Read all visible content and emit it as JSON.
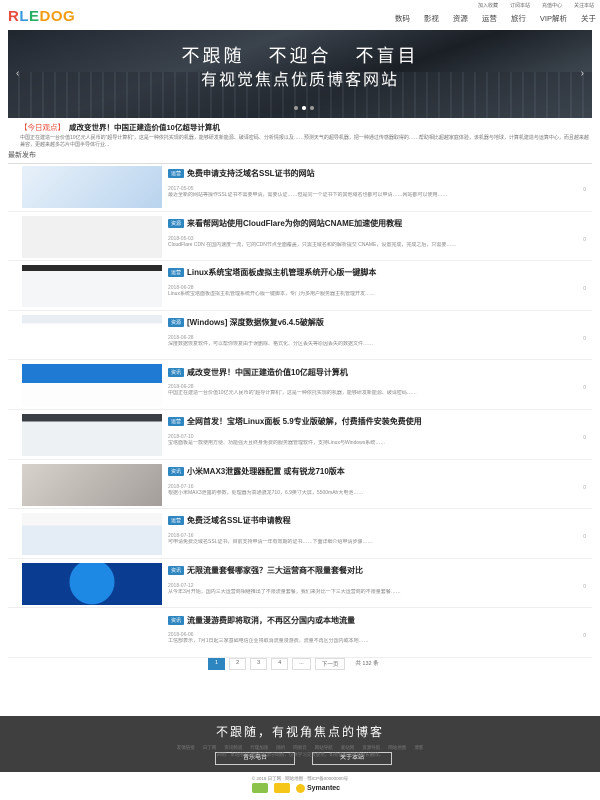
{
  "header": {
    "logo": [
      "R",
      "L",
      "E",
      "DOG"
    ],
    "top_links": [
      "加入收藏",
      "订阅本站",
      "充值中心",
      "关注本站"
    ],
    "nav": [
      "数码",
      "影视",
      "资源",
      "运营",
      "旅行",
      "VIP解析",
      "关于"
    ]
  },
  "banner": {
    "line1": "不跟随  不迎合  不盲目",
    "line2": "有视觉焦点优质博客网站",
    "prev": "‹",
    "next": "›"
  },
  "today": {
    "tag": "【今日观点】",
    "title": "咸改变世界！中国正建造价值10亿超导计算机",
    "excerpt": "中国正在建造一台价值10亿元人民币的“超导计算机”，这是一种依托实现的机器，能够研发新能源、破译密码、分析情报以及……预测天气的超导机器，把一种通过传感器取得的……帮助相比超越家庭体验，该机器与地球，计算机建造与运算中心，而且越来越兼容，更越来越多芯片中国半导体行业..."
  },
  "section_title": "最新发布",
  "posts": [
    {
      "cat": "运营",
      "title": "免费申请支持泛域名SSL证书的网站",
      "date": "2017-05-05",
      "excerpt": "最近全新的网站等操作SSL证书不需要申请，需要认证……但是同一个证书下的其他域名也都可以申请……网站都可以使用……",
      "views": "0"
    },
    {
      "cat": "资源",
      "title": "来看帮网站使用CloudFlare为你的网站CNAME加速使用教程",
      "date": "2018-05-03",
      "excerpt": "CloudFlare CDN 在国内速度一流，它的CDN节点全面覆盖，只需主域名和的解析提交 CNAME，设置完成，完成之后，只需要……",
      "views": "0"
    },
    {
      "cat": "运营",
      "title": "Linux系统宝塔面板虚拟主机管理系统开心版一键脚本",
      "date": "2018-06-28",
      "excerpt": "Linux系统宝塔面板虚拟主机管理系统开心版一键脚本，专门为多用户服务器主机管理开发……",
      "views": "0"
    },
    {
      "cat": "资源",
      "title": "[Windows] 深度数据恢复v6.4.5破解版",
      "date": "2018-06-28",
      "excerpt": "深度数据恢复软件，可以帮你恢复由于误删除、格式化、分区丢失等原因丢失的数据文件……",
      "views": "0"
    },
    {
      "cat": "资讯",
      "title": "咸改变世界！中国正建造价值10亿超导计算机",
      "date": "2018-06-28",
      "excerpt": "中国正在建造一台价值10亿元人民币的“超导计算机”，这是一种依托实现的机器，能够研发新能源、破译密码……",
      "views": "0"
    },
    {
      "cat": "运营",
      "title": "全网首发！宝塔Linux面板 5.9专业版破解，付费插件安装免费使用",
      "date": "2018-07-10",
      "excerpt": "宝塔面板是一款使用方便、功能强大且终身免费的服务器管理软件，支持Linux与Windows系统……",
      "views": "0"
    },
    {
      "cat": "资讯",
      "title": "小米MAX3泄露处理器配置 或有锐龙710版本",
      "date": "2018-07-16",
      "excerpt": "根据小米MAX3泄露的参数，处理器为高通骁龙710，6.9英寸大屏，5500mAh大电池……",
      "views": "0"
    },
    {
      "cat": "运营",
      "title": "免费泛域名SSL证书申请教程",
      "date": "2018-07-16",
      "excerpt": "可申请免费泛域名SSL证书，目前支持申请一年有效期的证书……下面详细介绍申请步骤……",
      "views": "0"
    },
    {
      "cat": "资讯",
      "title": "无限流量套餐哪家强？三大运营商不限量套餐对比",
      "date": "2018-07-12",
      "excerpt": "从今年3月开始，国内三大运营商相继推出了不限流量套餐，我们来对比一下三大运营商的不限量套餐……",
      "views": "0"
    },
    {
      "cat": "资讯",
      "title": "流量漫游费即将取消，不再区分国内或本地流量",
      "date": "2018-06-06",
      "excerpt": "工信部表示，7月1日起三家基础电信企业将取消流量漫游费，流量不再区分国内或本地……",
      "views": "0"
    }
  ],
  "pager": {
    "pages": [
      "1",
      "2",
      "3",
      "4",
      "...",
      "下一页"
    ],
    "total": "共 132 条"
  },
  "footer": {
    "slogan": "不跟随，有视角焦点的博客",
    "btn1": "音乐电台",
    "btn2": "关于本站",
    "links": [
      "友情链接",
      "日丁网",
      "资讯频道",
      "代理加速",
      "随机",
      "网易云",
      "网站导航",
      "爱站网",
      "资源导航",
      "网站地图",
      "博客"
    ],
    "notice": "声明：本站所有资源均来源于网络，仅供学习交流使用，如有侵权请联系站长删除。",
    "copyright": "© 2018 日丁网 · 网站地图 · 鄂ICP备00000000号",
    "symantec": "Symantec"
  },
  "colors": {
    "accent": "#2e86c1",
    "red": "#e74c3c",
    "footer_bg": "#3f3f3f"
  }
}
